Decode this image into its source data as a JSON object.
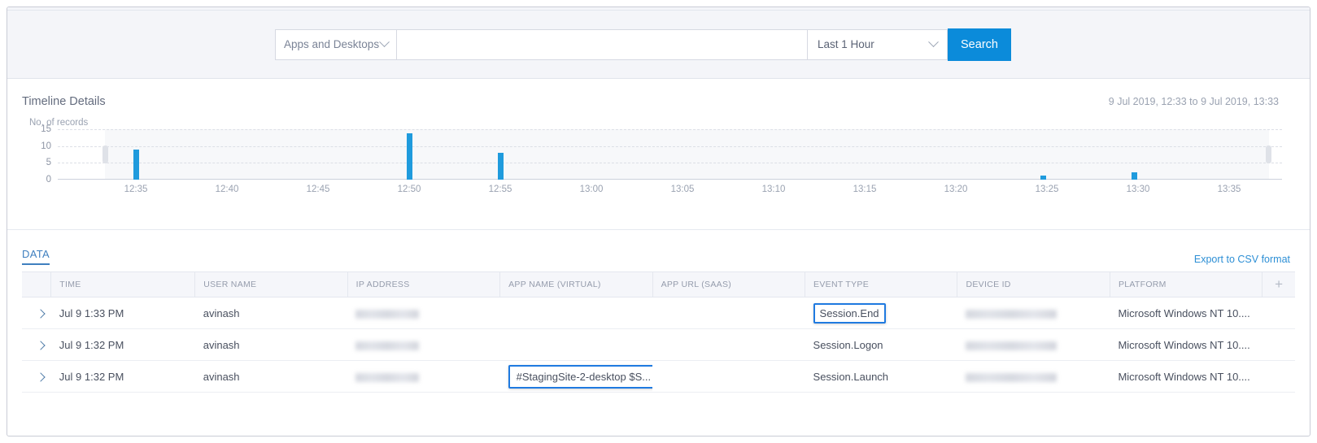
{
  "search": {
    "scope_label": "Apps and Desktops",
    "scope_caret": "chevron-down-icon",
    "query_value": "",
    "query_placeholder": "",
    "time_range_label": "Last 1 Hour",
    "search_button": "Search"
  },
  "timeline": {
    "title": "Timeline Details",
    "range": "9 Jul 2019, 12:33 to 9 Jul 2019, 13:33",
    "y_axis_caption": "No. of records"
  },
  "chart_data": {
    "type": "bar",
    "title": "Timeline Details",
    "xlabel": "",
    "ylabel": "No. of records",
    "ylim": [
      0,
      15
    ],
    "yticks": [
      0,
      5,
      10,
      15
    ],
    "xticks": [
      "12:35",
      "12:40",
      "12:45",
      "12:50",
      "12:55",
      "13:00",
      "13:05",
      "13:10",
      "13:15",
      "13:20",
      "13:25",
      "13:30",
      "13:35"
    ],
    "grid": true,
    "legend": "none",
    "categories": [
      "12:35",
      "12:50",
      "12:55",
      "13:25",
      "13:30"
    ],
    "values": [
      9,
      14,
      8,
      1,
      2
    ],
    "bar_color": "#1f9bdd"
  },
  "data_section": {
    "tab_label": "DATA",
    "export_label": "Export to CSV format",
    "add_column_icon": "plus-icon",
    "columns": [
      "TIME",
      "USER NAME",
      "IP ADDRESS",
      "APP NAME (VIRTUAL)",
      "APP URL (SAAS)",
      "EVENT TYPE",
      "DEVICE ID",
      "PLATFORM"
    ],
    "rows": [
      {
        "time": "Jul 9 1:33 PM",
        "user_name": "avinash",
        "ip_address": "",
        "app_name_virtual": "",
        "app_url_saas": "",
        "event_type": "Session.End",
        "device_id": "",
        "platform": "Microsoft Windows NT 10...."
      },
      {
        "time": "Jul 9 1:32 PM",
        "user_name": "avinash",
        "ip_address": "",
        "app_name_virtual": "",
        "app_url_saas": "",
        "event_type": "Session.Logon",
        "device_id": "",
        "platform": "Microsoft Windows NT 10...."
      },
      {
        "time": "Jul 9 1:32 PM",
        "user_name": "avinash",
        "ip_address": "",
        "app_name_virtual": "#StagingSite-2-desktop $S...",
        "app_url_saas": "",
        "event_type": "Session.Launch",
        "device_id": "",
        "platform": "Microsoft Windows NT 10...."
      }
    ]
  },
  "colors": {
    "accent": "#0b8bda",
    "highlight_box": "#1f7ae0",
    "link": "#2d8fd5",
    "bar": "#1f9bdd"
  }
}
